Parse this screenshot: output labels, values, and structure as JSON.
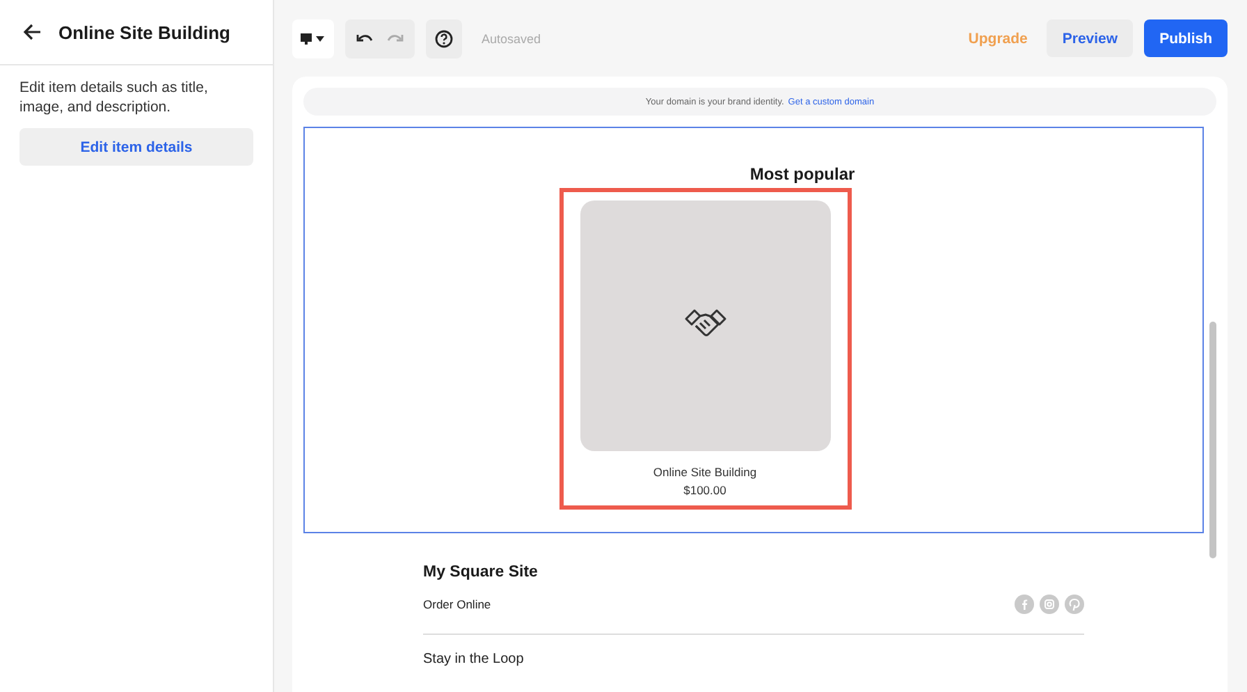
{
  "sidebar": {
    "title": "Online Site Building",
    "description": "Edit item details such as title, image, and description.",
    "button": "Edit item details"
  },
  "toolbar": {
    "status": "Autosaved",
    "upgrade": "Upgrade",
    "preview": "Preview",
    "publish": "Publish"
  },
  "banner": {
    "text": "Your domain is your brand identity.",
    "link": "Get a custom domain"
  },
  "section": {
    "heading": "Most popular",
    "selected": true,
    "highlighted": true,
    "products": [
      {
        "kind": "picture",
        "name": "Online Site Building",
        "price": "$100.00"
      }
    ]
  },
  "footer": {
    "site_name": "My Square Site",
    "link": "Order Online",
    "next_heading": "Stay in the Loop"
  }
}
